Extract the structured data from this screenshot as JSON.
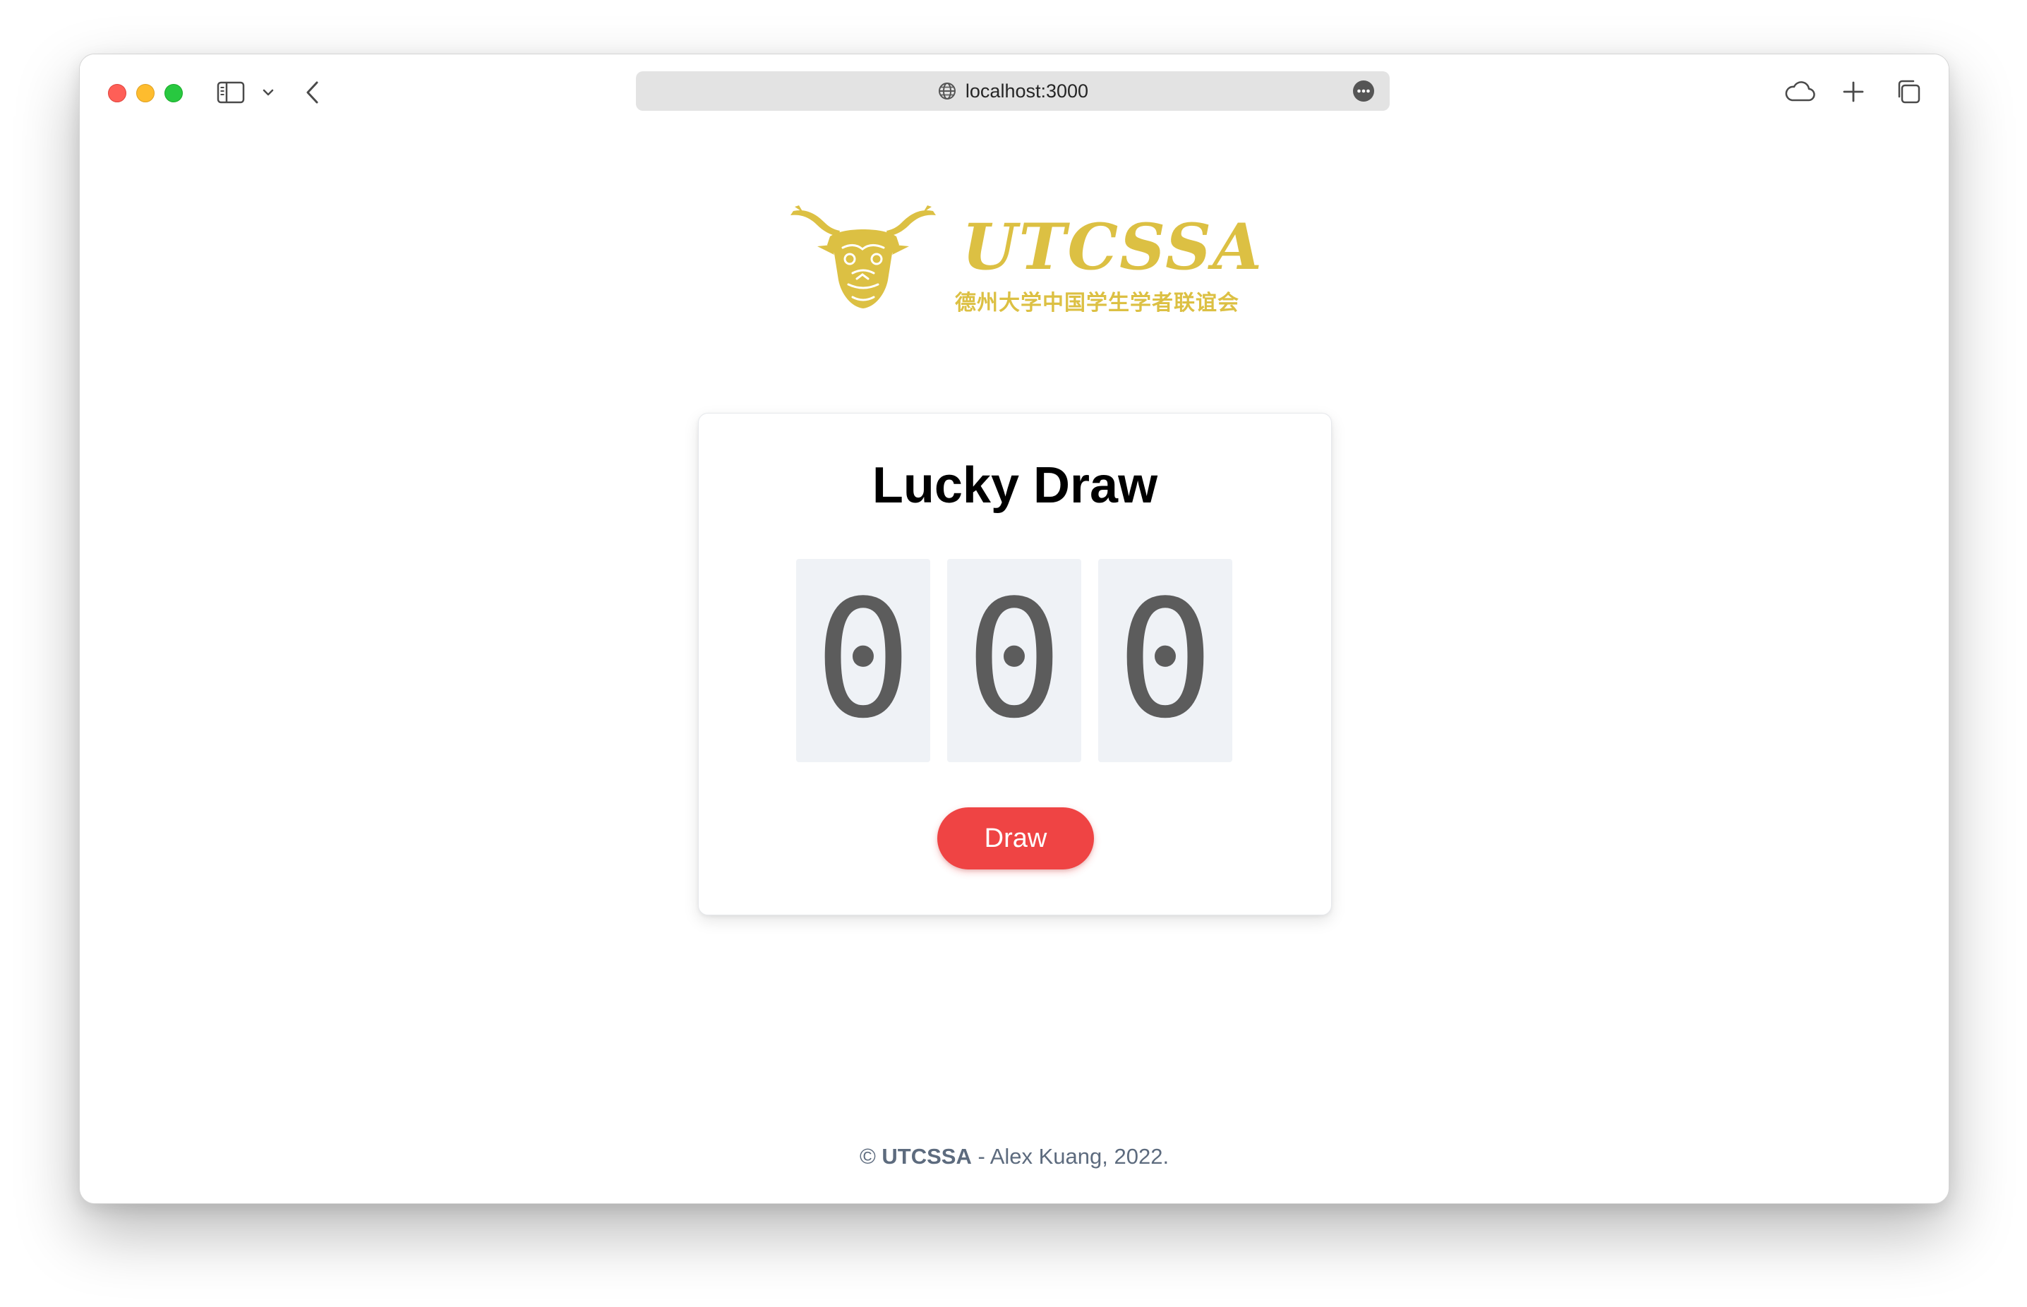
{
  "browser": {
    "url": "localhost:3000",
    "icons": [
      "sidebar-icon",
      "chevron-down-icon",
      "back-icon",
      "globe-icon",
      "more-icon",
      "cloud-icon",
      "plus-icon",
      "tabs-icon"
    ]
  },
  "logo": {
    "text_en": "UTCSSA",
    "text_zh": "德州大学中国学生学者联谊会",
    "color": "#dcc043"
  },
  "card": {
    "title": "Lucky Draw",
    "digits": [
      "0",
      "0",
      "0"
    ],
    "button_label": "Draw",
    "button_color": "#ef4444"
  },
  "footer": {
    "copyright": "©",
    "org": "UTCSSA",
    "rest": " - Alex Kuang, 2022."
  }
}
